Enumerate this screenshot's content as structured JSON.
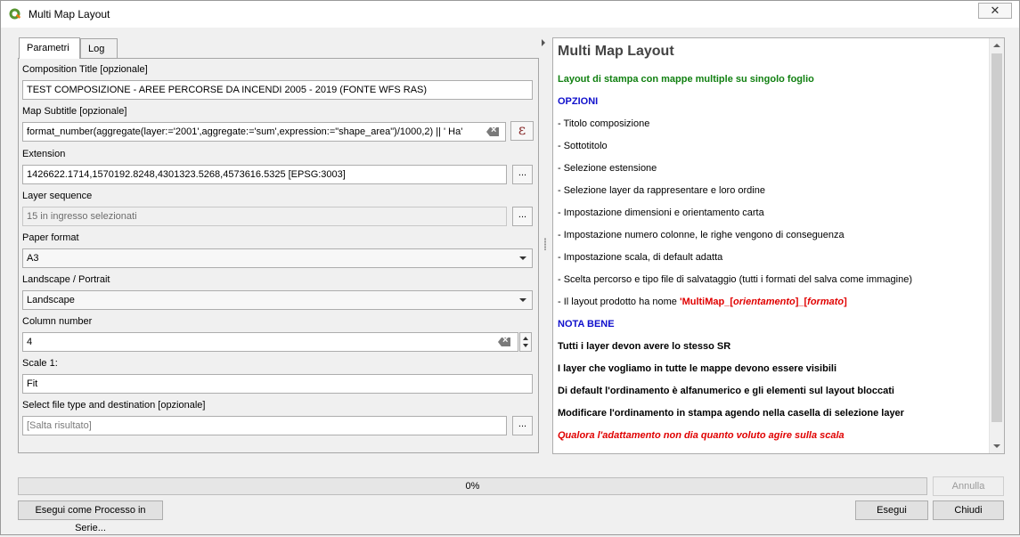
{
  "window": {
    "title": "Multi Map Layout",
    "close_glyph": "✕"
  },
  "tabs": [
    {
      "label": "Parametri"
    },
    {
      "label": "Log"
    }
  ],
  "form": {
    "composition_title": {
      "label": "Composition Title [opzionale]",
      "value": "TEST COMPOSIZIONE - AREE PERCORSE DA INCENDI 2005 - 2019 (FONTE WFS RAS)"
    },
    "map_subtitle": {
      "label": "Map Subtitle [opzionale]",
      "value": "format_number(aggregate(layer:='2001',aggregate:='sum',expression:=\"shape_area\")/1000,2) || ' Ha'",
      "expr_glyph": "ε"
    },
    "extension": {
      "label": "Extension",
      "value": "1426622.1714,1570192.8248,4301323.5268,4573616.5325 [EPSG:3003]"
    },
    "layer_sequence": {
      "label": "Layer sequence",
      "value": "15 in ingresso selezionati"
    },
    "paper_format": {
      "label": "Paper format",
      "value": "A3"
    },
    "orientation": {
      "label": "Landscape / Portrait",
      "value": "Landscape"
    },
    "column_number": {
      "label": "Column number",
      "value": "4"
    },
    "scale": {
      "label": "Scale 1:",
      "value": "Fit"
    },
    "file_destination": {
      "label": "Select file type and destination [opzionale]",
      "placeholder": "[Salta risultato]"
    },
    "dots_label": "..."
  },
  "help": {
    "title": "Multi Map Layout",
    "subtitle": "Layout di stampa con mappe multiple su singolo foglio",
    "options_heading": "OPZIONI",
    "options": [
      "- Titolo composizione",
      "- Sottotitolo",
      "- Selezione estensione",
      "- Selezione layer da rappresentare e loro ordine",
      "- Impostazione dimensioni e orientamento carta",
      "- Impostazione numero colonne, le righe vengono di conseguenza",
      "- Impostazione scala, di default adatta",
      "- Scelta percorso e tipo file di salvataggio (tutti i formati del salva come immagine)"
    ],
    "layout_name_prefix": "- Il layout prodotto ha nome ",
    "layout_name_a": "'MultiMap_[",
    "layout_name_b": "orientamento",
    "layout_name_c": "]_[",
    "layout_name_d": "formato",
    "layout_name_e": "]",
    "nota_heading": "NOTA BENE",
    "notes": [
      "Tutti i layer devon avere lo stesso SR",
      "I layer che vogliamo in tutte le mappe devono essere visibili",
      "Di default l'ordinamento è alfanumerico e gli elementi sul layout bloccati",
      "Modificare l'ordinamento in stampa agendo nella casella di selezione layer"
    ],
    "warning": "Qualora l'adattamento non dia quanto voluto agire sulla scala"
  },
  "progress": {
    "value_percent": 0,
    "label": "0%"
  },
  "buttons": {
    "cancel": "Annulla",
    "batch": "Esegui come Processo in Serie...",
    "run": "Esegui",
    "close": "Chiudi"
  }
}
